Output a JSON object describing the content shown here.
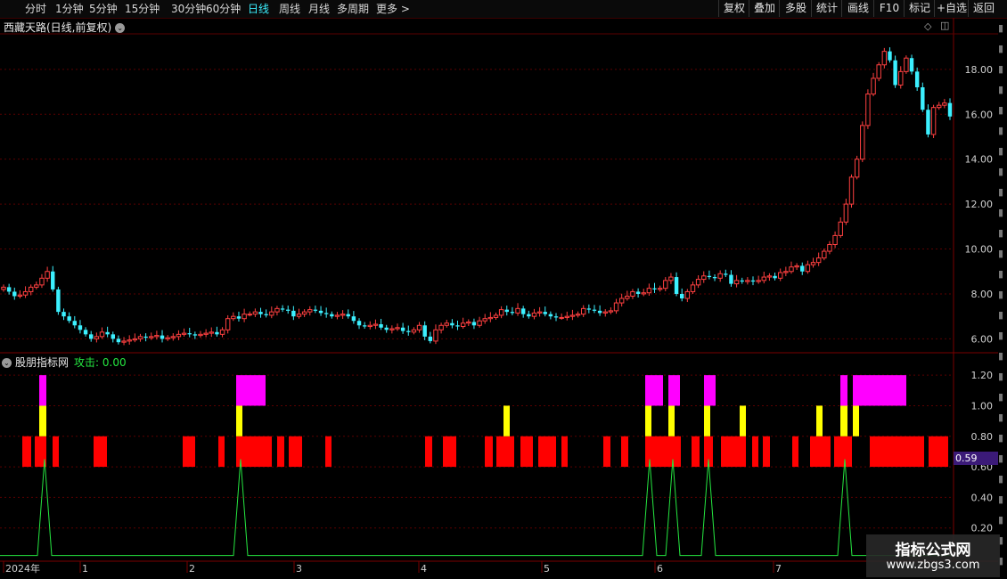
{
  "toolbar": {
    "timeframes": [
      "分时",
      "1分钟",
      "5分钟",
      "15分钟",
      "30分钟",
      "60分钟",
      "日线",
      "周线",
      "月线",
      "多周期",
      "更多 >"
    ],
    "active_timeframe": "日线",
    "right_buttons": [
      "复权",
      "叠加",
      "多股",
      "统计",
      "画线",
      "F10",
      "标记",
      "+自选",
      "返回"
    ]
  },
  "main_title": "西藏天路(日线,前复权)",
  "indicator_title": "股朋指标网",
  "indicator_value_label": "攻击: 0.00",
  "value_tag": "0.59",
  "watermark": {
    "line1": "指标公式网",
    "line2": "www.zbgs3.com"
  },
  "colors": {
    "up": "#ff4040",
    "down": "#3cf0ff",
    "grid": "#5a0000",
    "signal_line": "#25e640",
    "magenta": "#ff00ff",
    "yellow": "#ffff00",
    "red": "#ff0000"
  },
  "chart_data": [
    {
      "type": "candlestick",
      "price_axis_ticks": [
        "6.00",
        "8.00",
        "10.00",
        "12.00",
        "14.00",
        "16.00",
        "18.00"
      ],
      "ylim": [
        5.5,
        19.5
      ],
      "x_labels": [
        "2024年",
        "1",
        "2",
        "3",
        "4",
        "5",
        "6",
        "7"
      ],
      "closes": [
        8.3,
        8.1,
        7.9,
        7.95,
        8.1,
        8.3,
        8.4,
        8.7,
        9.0,
        8.2,
        7.2,
        7.0,
        6.8,
        6.6,
        6.4,
        6.2,
        6.0,
        6.1,
        6.3,
        6.2,
        6.0,
        5.85,
        5.9,
        5.95,
        6.0,
        6.1,
        6.05,
        6.1,
        6.15,
        6.0,
        6.05,
        6.1,
        6.2,
        6.25,
        6.2,
        6.15,
        6.2,
        6.25,
        6.3,
        6.2,
        6.4,
        6.9,
        7.0,
        6.9,
        7.1,
        7.1,
        7.2,
        7.1,
        7.05,
        7.2,
        7.35,
        7.3,
        7.25,
        7.0,
        7.1,
        7.2,
        7.3,
        7.25,
        7.15,
        7.1,
        7.0,
        7.05,
        7.1,
        7.0,
        6.8,
        6.6,
        6.55,
        6.6,
        6.65,
        6.5,
        6.4,
        6.45,
        6.5,
        6.35,
        6.3,
        6.4,
        6.6,
        6.1,
        5.9,
        6.4,
        6.6,
        6.7,
        6.6,
        6.55,
        6.7,
        6.75,
        6.6,
        6.8,
        6.9,
        6.95,
        7.05,
        7.3,
        7.2,
        7.15,
        7.35,
        7.1,
        7.0,
        7.15,
        7.2,
        7.1,
        7.0,
        6.95,
        6.95,
        7.0,
        7.05,
        7.1,
        7.35,
        7.3,
        7.25,
        7.15,
        7.2,
        7.25,
        7.6,
        7.8,
        7.9,
        8.1,
        8.0,
        8.05,
        8.25,
        8.2,
        8.25,
        8.6,
        8.75,
        8.0,
        7.8,
        8.1,
        8.4,
        8.65,
        8.8,
        8.75,
        8.7,
        8.9,
        8.85,
        8.45,
        8.6,
        8.55,
        8.6,
        8.55,
        8.6,
        8.75,
        8.8,
        8.7,
        8.95,
        9.0,
        9.2,
        9.25,
        9.0,
        9.3,
        9.4,
        9.6,
        9.9,
        10.2,
        10.6,
        11.2,
        12.0,
        13.2,
        14.0,
        15.5,
        16.9,
        17.6,
        18.2,
        18.8,
        18.4,
        17.3,
        17.9,
        18.5,
        17.9,
        17.2,
        16.2,
        15.1,
        16.3,
        16.4,
        16.5,
        15.9
      ],
      "up_color": "#ff4040",
      "down_color": "#3cf0ff"
    },
    {
      "type": "bar",
      "indicator_axis_ticks": [
        "0.20",
        "0.40",
        "0.60",
        "0.80",
        "1.00",
        "1.20"
      ],
      "ylim": [
        0,
        1.3
      ],
      "magenta_blocks": [
        [
          44,
          8
        ],
        [
          265,
          33
        ],
        [
          724,
          20
        ],
        [
          750,
          13
        ],
        [
          790,
          13
        ],
        [
          943,
          8
        ],
        [
          957,
          60
        ]
      ],
      "yellow_blocks": [
        [
          44,
          8
        ],
        [
          265,
          7
        ],
        [
          565,
          7
        ],
        [
          724,
          7
        ],
        [
          750,
          7
        ],
        [
          790,
          7
        ],
        [
          830,
          7
        ],
        [
          916,
          7
        ],
        [
          943,
          8
        ],
        [
          957,
          7
        ]
      ],
      "red_blocks": [
        [
          25,
          10
        ],
        [
          39,
          13
        ],
        [
          59,
          7
        ],
        [
          105,
          15
        ],
        [
          205,
          14
        ],
        [
          245,
          7
        ],
        [
          265,
          40
        ],
        [
          311,
          8
        ],
        [
          324,
          15
        ],
        [
          365,
          7
        ],
        [
          477,
          8
        ],
        [
          497,
          15
        ],
        [
          544,
          9
        ],
        [
          557,
          20
        ],
        [
          584,
          14
        ],
        [
          604,
          20
        ],
        [
          630,
          7
        ],
        [
          677,
          8
        ],
        [
          697,
          8
        ],
        [
          724,
          40
        ],
        [
          776,
          9
        ],
        [
          790,
          10
        ],
        [
          809,
          28
        ],
        [
          844,
          7
        ],
        [
          856,
          8
        ],
        [
          889,
          7
        ],
        [
          909,
          23
        ],
        [
          936,
          20
        ],
        [
          976,
          61
        ],
        [
          1042,
          22
        ]
      ],
      "spikes": [
        50,
        270,
        729,
        755,
        795,
        948
      ]
    }
  ]
}
